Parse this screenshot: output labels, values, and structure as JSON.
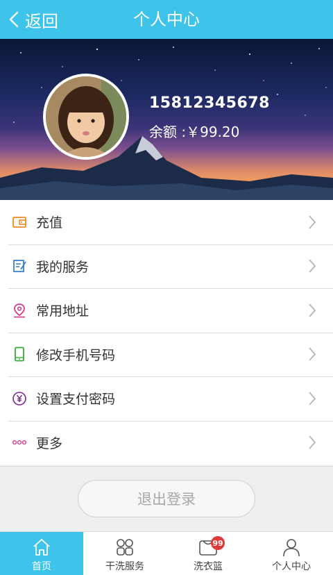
{
  "header": {
    "back_label": "返回",
    "title": "个人中心"
  },
  "profile": {
    "phone": "15812345678",
    "balance_text": "余额 :￥99.20"
  },
  "menu": [
    {
      "label": "充值",
      "icon": "wallet-icon",
      "color": "#f08a24"
    },
    {
      "label": "我的服务",
      "icon": "document-edit-icon",
      "color": "#3b7fd0"
    },
    {
      "label": "常用地址",
      "icon": "location-pin-icon",
      "color": "#d43a8e"
    },
    {
      "label": "修改手机号码",
      "icon": "mobile-phone-icon",
      "color": "#3aaa3a"
    },
    {
      "label": "设置支付密码",
      "icon": "yen-coin-icon",
      "color": "#7c2b8f"
    },
    {
      "label": "更多",
      "icon": "more-dots-icon",
      "color": "#d43a8e"
    }
  ],
  "logout_label": "退出登录",
  "tabs": [
    {
      "label": "首页",
      "icon": "home-icon",
      "active": true
    },
    {
      "label": "干洗服务",
      "icon": "grid-icon",
      "active": false
    },
    {
      "label": "洗衣篮",
      "icon": "basket-icon",
      "badge": "99",
      "active": false
    },
    {
      "label": "个人中心",
      "icon": "user-icon",
      "active": false
    }
  ],
  "colors": {
    "accent": "#3ec3ea",
    "badge": "#e23a3a"
  }
}
